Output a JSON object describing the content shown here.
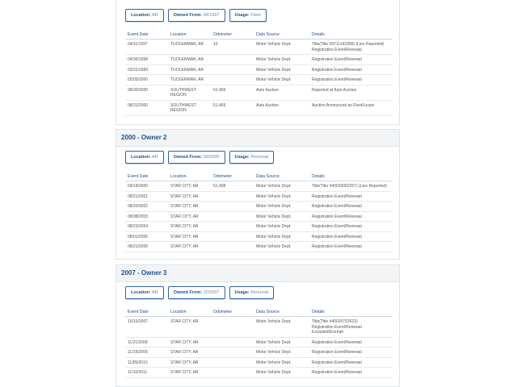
{
  "columns": [
    "Event Date",
    "Location",
    "Odometer",
    "Data Source",
    "Details"
  ],
  "owners": [
    {
      "title": "",
      "location_label": "Location:",
      "location": "AR",
      "owned_label": "Owned From:",
      "owned": "04/1997",
      "usage_label": "Usage:",
      "usage": "Fleet",
      "rows": [
        {
          "date": "04/11/1997",
          "location": "TUCKERMAN, AR",
          "odometer": "10",
          "source": "Motor Vehicle Dept.",
          "details": "Title(Title #9711141899) (Lien Reported)\nRegistration Event/Renewal"
        },
        {
          "date": "04/30/1998",
          "location": "TUCKERMAN, AR",
          "odometer": "",
          "source": "Motor Vehicle Dept.",
          "details": "Registration Event/Renewal"
        },
        {
          "date": "03/31/1999",
          "location": "TUCKERMAN, AR",
          "odometer": "",
          "source": "Motor Vehicle Dept.",
          "details": "Registration Event/Renewal"
        },
        {
          "date": "05/05/2000",
          "location": "TUCKERMAN, AR",
          "odometer": "",
          "source": "Motor Vehicle Dept.",
          "details": "Registration Event/Renewal"
        },
        {
          "date": "08/30/2000",
          "location": "SOUTHWEST\nREGION",
          "odometer": "51,469",
          "source": "Auto Auction",
          "details": "Reported at Auto Auction"
        },
        {
          "date": "08/31/2000",
          "location": "SOUTHWEST\nREGION",
          "odometer": "51,469",
          "source": "Auto Auction",
          "details": "Auction Announced as Fleet/Lease"
        }
      ]
    },
    {
      "title": "2000 - Owner  2",
      "location_label": "Location:",
      "location": "AR",
      "owned_label": "Owned From:",
      "owned": "09/2000",
      "usage_label": "Usage:",
      "usage": "Personal",
      "rows": [
        {
          "date": "09/18/2000",
          "location": "STAR CITY, AR",
          "odometer": "51,498",
          "source": "Motor Vehicle Dept.",
          "details": "Title(Title #40020002257) (Lien Reported)"
        },
        {
          "date": "08/21/2001",
          "location": "STAR CITY, AR",
          "odometer": "",
          "source": "Motor Vehicle Dept.",
          "details": "Registration Event/Renewal"
        },
        {
          "date": "08/20/2002",
          "location": "STAR CITY, AR",
          "odometer": "",
          "source": "Motor Vehicle Dept.",
          "details": "Registration Event/Renewal"
        },
        {
          "date": "08/08/2003",
          "location": "STAR CITY, AR",
          "odometer": "",
          "source": "Motor Vehicle Dept.",
          "details": "Registration Event/Renewal"
        },
        {
          "date": "08/23/2004",
          "location": "STAR CITY, AR",
          "odometer": "",
          "source": "Motor Vehicle Dept.",
          "details": "Registration Event/Renewal"
        },
        {
          "date": "08/01/2005",
          "location": "STAR CITY, AR",
          "odometer": "",
          "source": "Motor Vehicle Dept.",
          "details": "Registration Event/Renewal"
        },
        {
          "date": "08/21/2006",
          "location": "STAR CITY, AR",
          "odometer": "",
          "source": "Motor Vehicle Dept.",
          "details": "Registration Event/Renewal"
        }
      ]
    },
    {
      "title": "2007 - Owner  3",
      "location_label": "Location:",
      "location": "AR",
      "owned_label": "Owned From:",
      "owned": "10/2007",
      "usage_label": "Usage:",
      "usage": "Personal",
      "rows": [
        {
          "date": "10/16/2007",
          "location": "STAR CITY, AR",
          "odometer": "",
          "source": "Motor Vehicle Dept.",
          "details": "Title(Title #40020702623)\nRegistration Event/Renewal\nExcluded/Exempt"
        },
        {
          "date": "11/21/2008",
          "location": "STAR CITY, AR",
          "odometer": "",
          "source": "Motor Vehicle Dept.",
          "details": "Registration Event/Renewal"
        },
        {
          "date": "11/19/2009",
          "location": "STAR CITY, AR",
          "odometer": "",
          "source": "Motor Vehicle Dept.",
          "details": "Registration Event/Renewal"
        },
        {
          "date": "11/05/2010",
          "location": "STAR CITY, AR",
          "odometer": "",
          "source": "Motor Vehicle Dept.",
          "details": "Registration Event/Renewal"
        },
        {
          "date": "11/16/2011",
          "location": "STAR CITY, AR",
          "odometer": "",
          "source": "Motor Vehicle Dept.",
          "details": "Registration Event/Renewal"
        }
      ]
    }
  ]
}
